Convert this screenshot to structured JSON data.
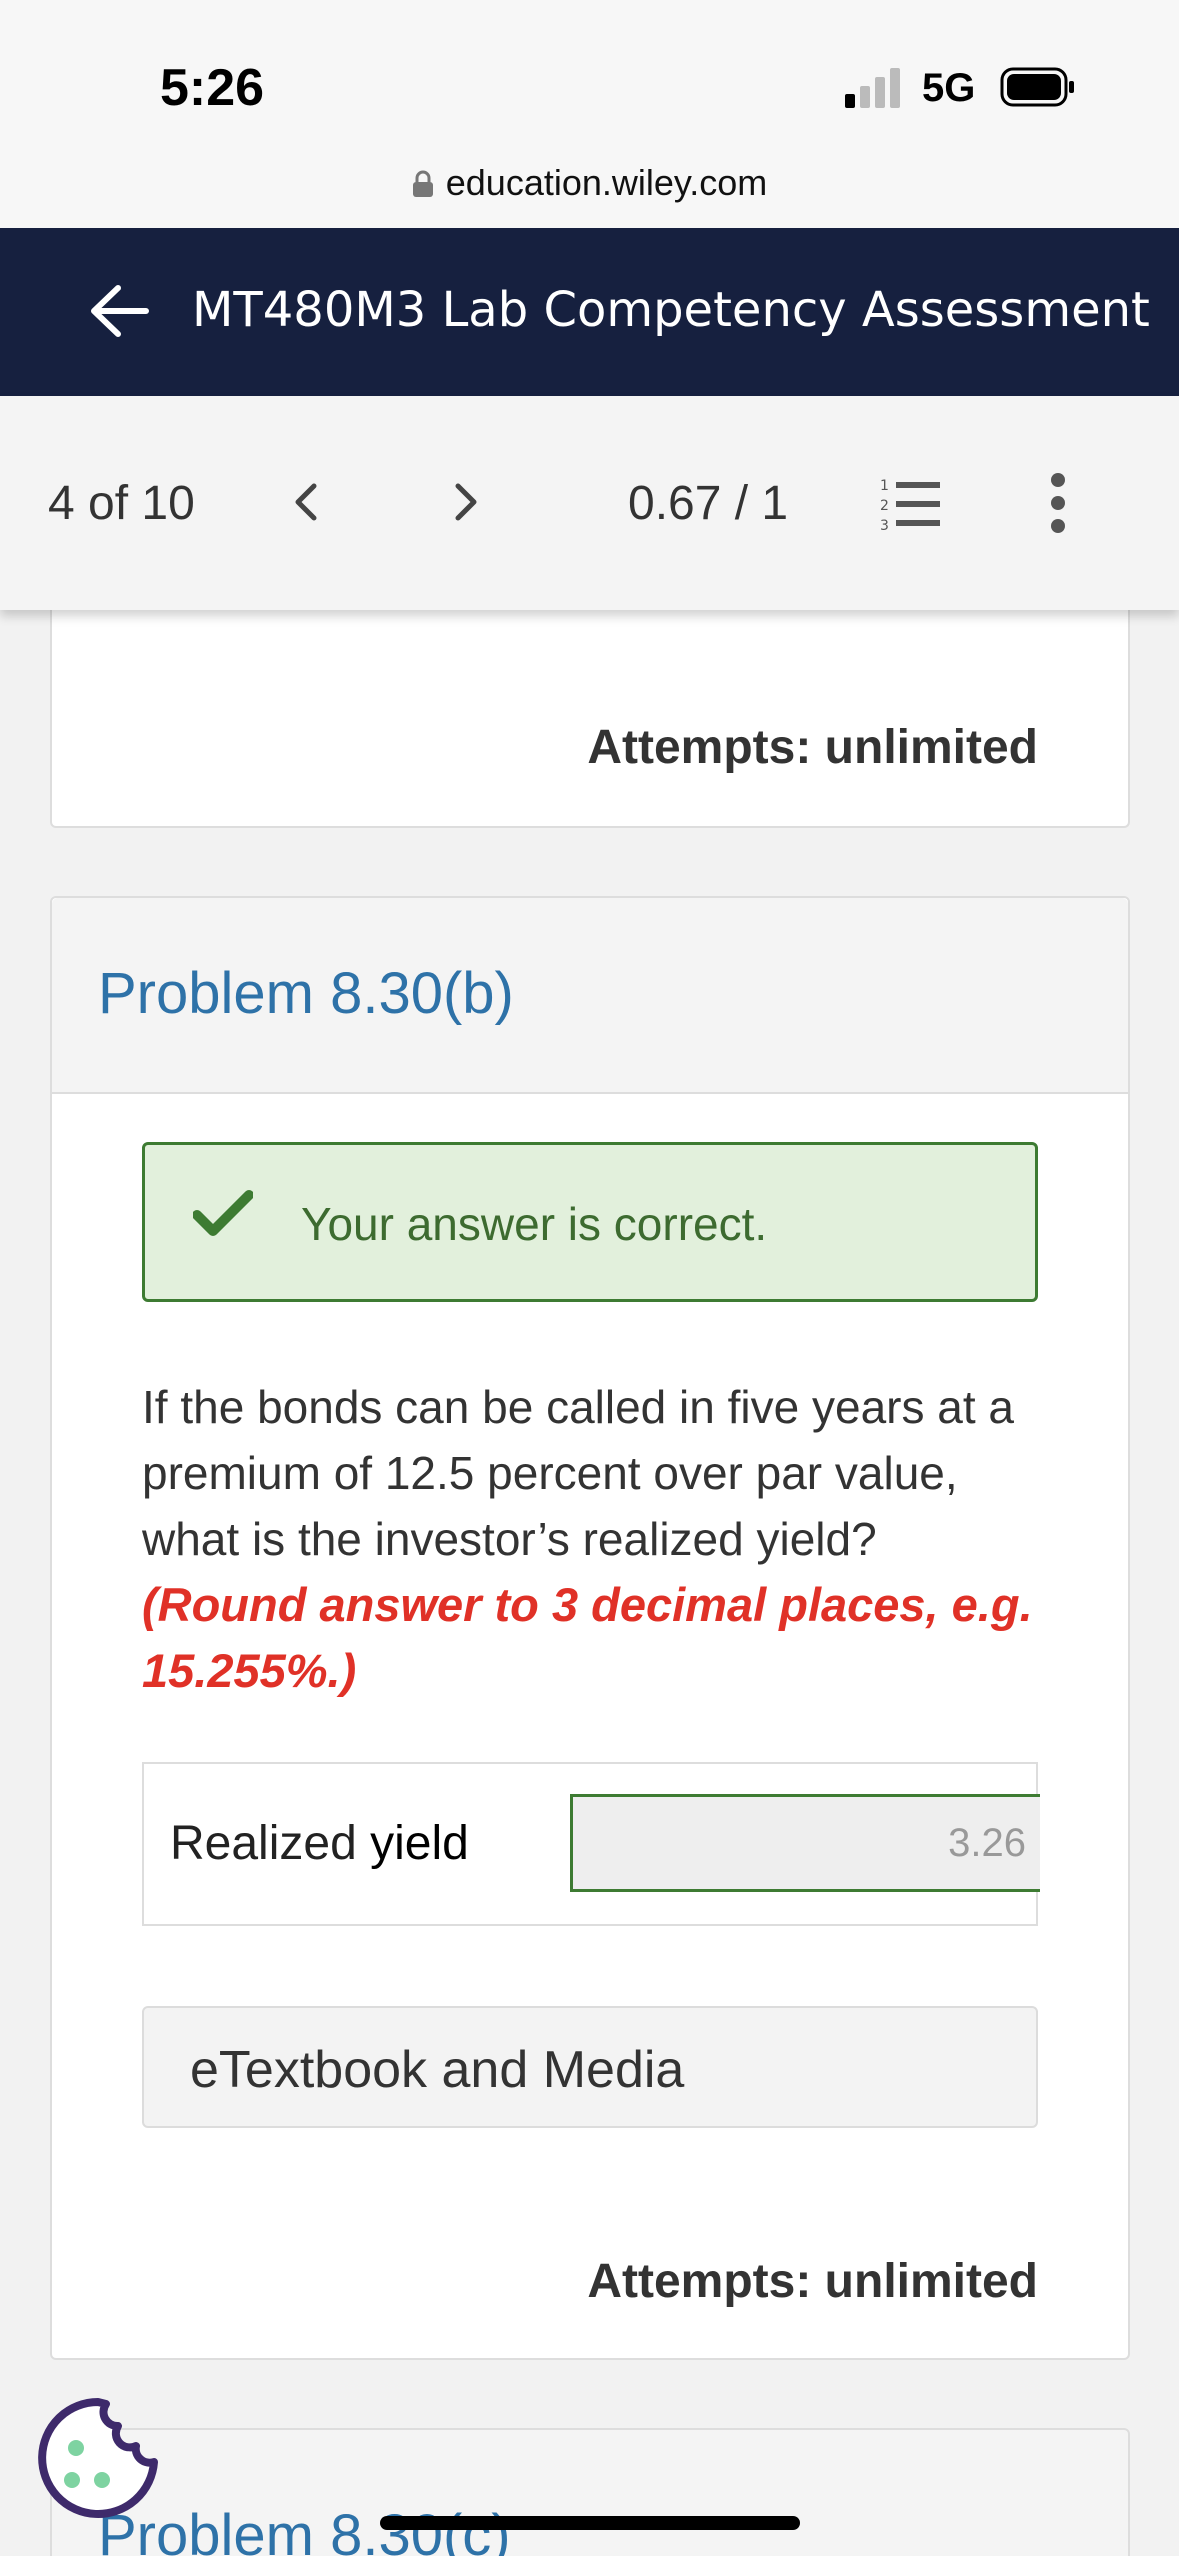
{
  "status_bar": {
    "time": "5:26",
    "network": "5G"
  },
  "browser": {
    "url": "education.wiley.com"
  },
  "header": {
    "title": "MT480M3 Lab Competency Assessment"
  },
  "nav": {
    "page_count": "4 of 10",
    "score": "0.67 / 1"
  },
  "previous_card": {
    "attempts": "Attempts: unlimited"
  },
  "problem": {
    "title": "Problem 8.30(b)",
    "feedback": "Your answer is correct.",
    "question": "If the bonds can be called in five years at a premium of 12.5 percent over par value, what is the investor’s realized yield?",
    "hint": "(Round answer to 3 decimal places, e.g. 15.255%.)",
    "answer_label_prefix": "Realized ",
    "answer_label_suffix": "yield",
    "answer_value": "3.26",
    "etextbook_label": "eTextbook and Media",
    "attempts": "Attempts: unlimited"
  },
  "next_problem": {
    "title": "Problem 8.30(c)"
  },
  "colors": {
    "header_bg": "#16203f",
    "link_blue": "#2e72a8",
    "success_green": "#3d7b32",
    "hint_red": "#e03127"
  }
}
